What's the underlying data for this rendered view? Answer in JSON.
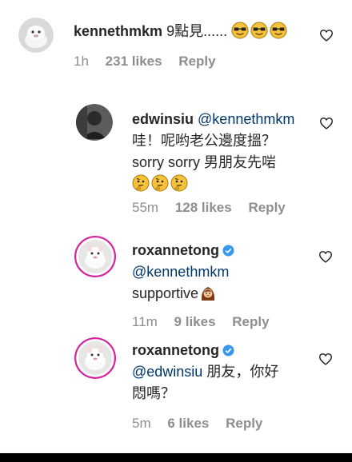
{
  "comments": [
    {
      "username": "kennethmkm",
      "text": "9點見......",
      "emoji_icons": [
        "smiling-face-with-sunglasses-icon",
        "smiling-face-with-sunglasses-icon",
        "smiling-face-with-sunglasses-icon"
      ],
      "time": "1h",
      "likes": "231 likes",
      "reply": "Reply"
    },
    {
      "username": "edwinsiu",
      "mention": "@kennethmkm",
      "text_line1": "哇！呢哟老公邊度搵？",
      "text_line2": "sorry sorry 男朋友先啱",
      "emoji_icons": [
        "thinking-face-icon",
        "thinking-face-icon",
        "thinking-face-icon"
      ],
      "time": "55m",
      "likes": "128 likes",
      "reply": "Reply"
    },
    {
      "username": "roxannetong",
      "mention": "@kennethmkm",
      "text": "supportive",
      "emoji_icons": [
        "woman-icon"
      ],
      "time": "11m",
      "likes": "9 likes",
      "reply": "Reply"
    },
    {
      "username": "roxannetong",
      "mention": "@edwinsiu",
      "text_line1": " 朋友，你好",
      "text_line2": "悶嗎？",
      "time": "5m",
      "likes": "6 likes",
      "reply": "Reply"
    }
  ],
  "colors": {
    "text": "#262626",
    "meta": "#8e8e8e",
    "mention": "#00376b",
    "verified": "#3897f0",
    "story_ring": "#d6249f"
  }
}
